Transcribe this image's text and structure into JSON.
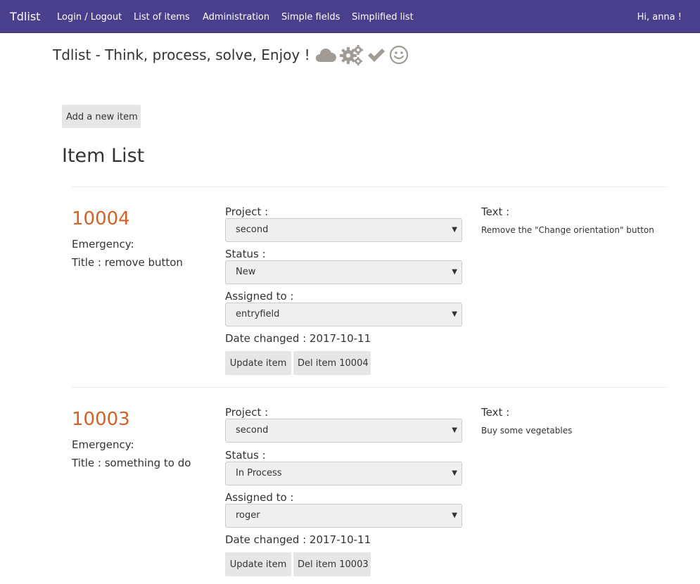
{
  "nav": {
    "brand": "Tdlist",
    "items": [
      "Login / Logout",
      "List of items",
      "Administration",
      "Simple fields",
      "Simplified list"
    ],
    "user_greeting": "Hi, anna !"
  },
  "header": {
    "tagline": "Tdlist - Think, process, solve, Enjoy !",
    "icons": [
      "cloud-icon",
      "gears-icon",
      "check-icon",
      "smiley-icon"
    ]
  },
  "toolbar": {
    "add_label": "Add a new item"
  },
  "list": {
    "title": "Item List",
    "items": [
      {
        "id": "10004",
        "emergency": "Emergency:",
        "title": "Title : remove button",
        "project_label": "Project :",
        "project": "second",
        "status_label": "Status :",
        "status": "New",
        "assigned_label": "Assigned to :",
        "assigned": "entryfield",
        "date_changed": "Date changed : 2017-10-11",
        "update_label": "Update item",
        "delete_label": "Del item 10004",
        "text_label": "Text :",
        "text": "Remove the \"Change orientation\" button"
      },
      {
        "id": "10003",
        "emergency": "Emergency:",
        "title": "Title : something to do",
        "project_label": "Project :",
        "project": "second",
        "status_label": "Status :",
        "status": "In Process",
        "assigned_label": "Assigned to :",
        "assigned": "roger",
        "date_changed": "Date changed : 2017-10-11",
        "update_label": "Update item",
        "delete_label": "Del item 10003",
        "text_label": "Text :",
        "text": "Buy some vegetables"
      }
    ]
  },
  "colors": {
    "navbar": "#4a3f8c",
    "item_id": "#d0622a",
    "icon": "#a09b95"
  }
}
